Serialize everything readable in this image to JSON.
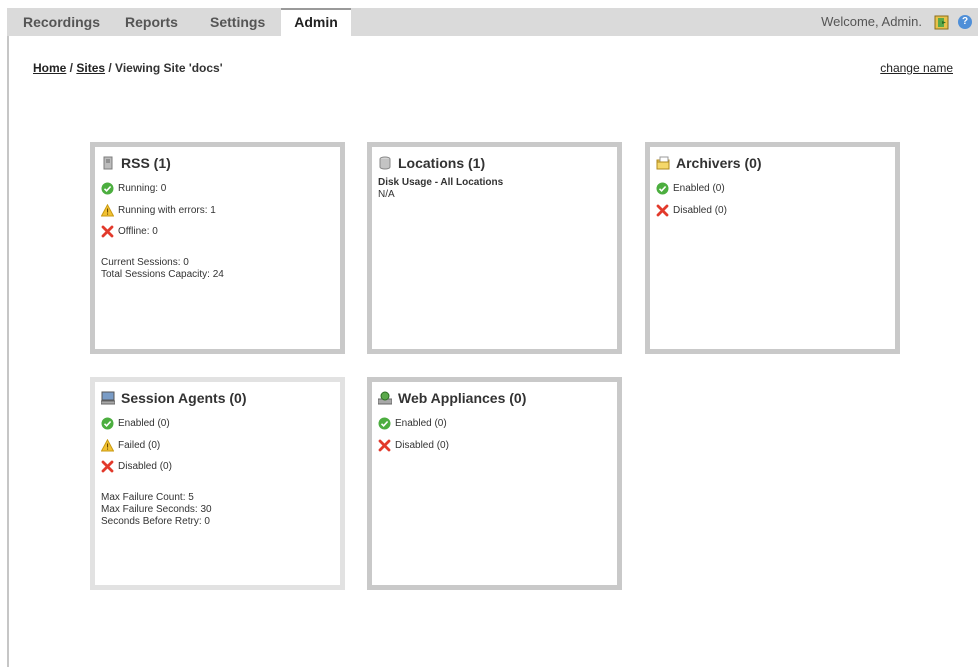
{
  "nav": {
    "tabs": [
      {
        "label": "Recordings"
      },
      {
        "label": "Reports"
      },
      {
        "label": "Settings"
      },
      {
        "label": "Admin"
      }
    ],
    "welcome": "Welcome, Admin.",
    "help_glyph": "?"
  },
  "breadcrumb": {
    "home": "Home",
    "sep1": " / ",
    "sites": "Sites",
    "rest": " / Viewing Site 'docs'"
  },
  "change_name": "change name",
  "panels": {
    "rss": {
      "title": "RSS (1)",
      "running": "Running: 0",
      "running_errors": "Running with errors: 1",
      "offline": "Offline: 0",
      "current_sessions": "Current Sessions: 0",
      "total_capacity": "Total Sessions Capacity: 24"
    },
    "locations": {
      "title": "Locations (1)",
      "disk_usage_label": "Disk Usage - All Locations",
      "disk_usage_value": "N/A"
    },
    "archivers": {
      "title": "Archivers (0)",
      "enabled": "Enabled (0)",
      "disabled": "Disabled (0)"
    },
    "session_agents": {
      "title": "Session Agents (0)",
      "enabled": "Enabled (0)",
      "failed": "Failed (0)",
      "disabled": "Disabled (0)",
      "max_failure_count": "Max Failure Count: 5",
      "max_failure_seconds": "Max Failure Seconds: 30",
      "seconds_before_retry": "Seconds Before Retry: 0"
    },
    "web_appliances": {
      "title": "Web Appliances (0)",
      "enabled": "Enabled (0)",
      "disabled": "Disabled (0)"
    }
  },
  "colors": {
    "ok": "#4cae3f",
    "warn": "#f2c233",
    "error": "#e23a2c",
    "panel_border": "#c9c9c9",
    "topbar": "#dadada"
  }
}
